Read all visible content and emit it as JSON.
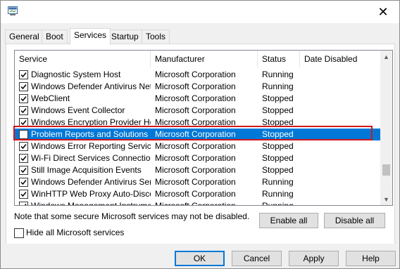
{
  "tabs": [
    {
      "label": "General",
      "active": false
    },
    {
      "label": "Boot",
      "active": false
    },
    {
      "label": "Services",
      "active": true
    },
    {
      "label": "Startup",
      "active": false
    },
    {
      "label": "Tools",
      "active": false
    }
  ],
  "columns": {
    "service": "Service",
    "manufacturer": "Manufacturer",
    "status": "Status",
    "date_disabled": "Date Disabled"
  },
  "rows": [
    {
      "checked": true,
      "service": "Diagnostic System Host",
      "manufacturer": "Microsoft Corporation",
      "status": "Running",
      "date": ""
    },
    {
      "checked": true,
      "service": "Windows Defender Antivirus Net...",
      "manufacturer": "Microsoft Corporation",
      "status": "Running",
      "date": ""
    },
    {
      "checked": true,
      "service": "WebClient",
      "manufacturer": "Microsoft Corporation",
      "status": "Stopped",
      "date": ""
    },
    {
      "checked": true,
      "service": "Windows Event Collector",
      "manufacturer": "Microsoft Corporation",
      "status": "Stopped",
      "date": ""
    },
    {
      "checked": true,
      "service": "Windows Encryption Provider Ho...",
      "manufacturer": "Microsoft Corporation",
      "status": "Stopped",
      "date": ""
    },
    {
      "checked": false,
      "selected": true,
      "service": "Problem Reports and Solutions C...",
      "manufacturer": "Microsoft Corporation",
      "status": "Stopped",
      "date": ""
    },
    {
      "checked": true,
      "service": "Windows Error Reporting Service",
      "manufacturer": "Microsoft Corporation",
      "status": "Stopped",
      "date": ""
    },
    {
      "checked": true,
      "service": "Wi-Fi Direct Services Connection...",
      "manufacturer": "Microsoft Corporation",
      "status": "Stopped",
      "date": ""
    },
    {
      "checked": true,
      "service": "Still Image Acquisition Events",
      "manufacturer": "Microsoft Corporation",
      "status": "Stopped",
      "date": ""
    },
    {
      "checked": true,
      "service": "Windows Defender Antivirus Ser...",
      "manufacturer": "Microsoft Corporation",
      "status": "Running",
      "date": ""
    },
    {
      "checked": true,
      "service": "WinHTTP Web Proxy Auto-Disco...",
      "manufacturer": "Microsoft Corporation",
      "status": "Running",
      "date": ""
    },
    {
      "checked": true,
      "service": "Windows Management Instrume...",
      "manufacturer": "Microsoft Corporation",
      "status": "Running",
      "date": ""
    }
  ],
  "note": "Note that some secure Microsoft services may not be disabled.",
  "enable_all": "Enable all",
  "disable_all": "Disable all",
  "hide_ms": {
    "label": "Hide all Microsoft services",
    "checked": false
  },
  "footer": {
    "ok": "OK",
    "cancel": "Cancel",
    "apply": "Apply",
    "help": "Help"
  },
  "scroll_position": 0.85,
  "colors": {
    "selection": "#0078d7",
    "highlight_box": "#d1161c"
  }
}
